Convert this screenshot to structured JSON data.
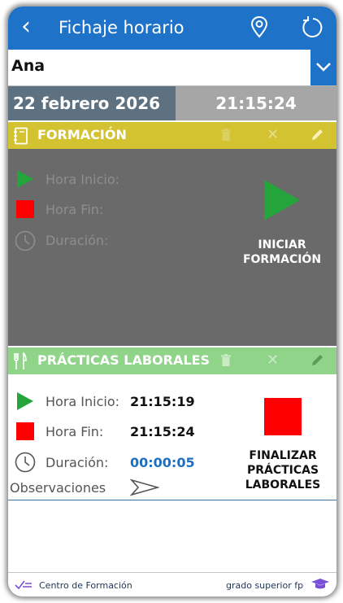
{
  "header": {
    "back_icon": "chevron-left-icon",
    "title": "Fichaje horario",
    "location_icon": "location-pin-icon",
    "refresh_icon": "refresh-icon"
  },
  "user_select": {
    "selected": "Ana"
  },
  "datetime": {
    "date": "22 febrero 2026",
    "time": "21:15:24"
  },
  "formacion": {
    "title": "FORMACIÓN",
    "color": "#d4c330",
    "hora_inicio_label": "Hora Inicio:",
    "hora_fin_label": "Hora Fin:",
    "duracion_label": "Duración:",
    "action_line1": "INICIAR",
    "action_line2": "FORMACIÓN"
  },
  "practicas": {
    "title": "PRÁCTICAS LABORALES",
    "color": "#90d48a",
    "hora_inicio_label": "Hora Inicio:",
    "hora_inicio_value": "21:15:19",
    "hora_fin_label": "Hora Fin:",
    "hora_fin_value": "21:15:24",
    "duracion_label": "Duración:",
    "duracion_value": "00:00:05",
    "observaciones_label": "Observaciones",
    "action_line1": "FINALIZAR",
    "action_line2": "PRÁCTICAS",
    "action_line3": "LABORALES"
  },
  "footer": {
    "left_label": "Centro de Formación",
    "right_label": "grado superior fp"
  }
}
